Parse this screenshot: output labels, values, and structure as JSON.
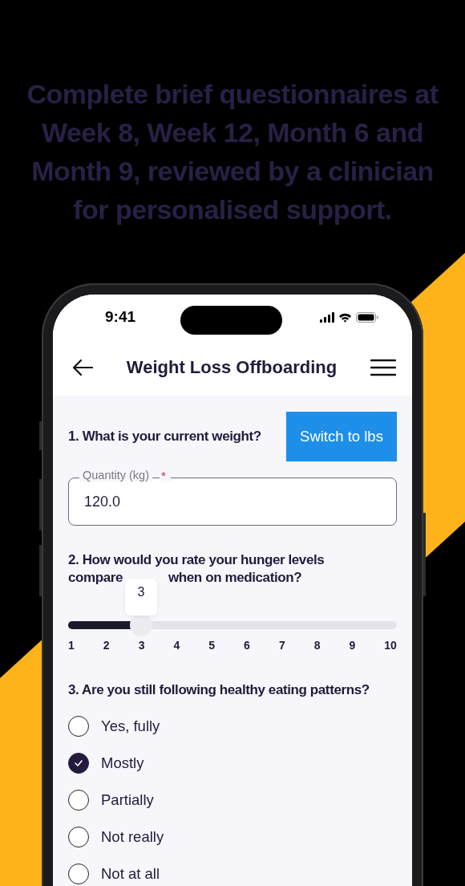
{
  "headline": "Complete brief questionnaires at Week 8, Week 12, Month 6 and Month 9, reviewed by a clinician for personalised support.",
  "status_bar": {
    "time": "9:41"
  },
  "header": {
    "title": "Weight Loss Offboarding"
  },
  "questions": [
    {
      "kind": "weight",
      "text": "1. What is your current weight?",
      "button": "Switch to lbs",
      "field": {
        "label": "Quantity (kg)",
        "required_mark": "*",
        "value": "120.0"
      }
    },
    {
      "kind": "slider",
      "text_lines": [
        "2. How would you rate your hunger levels",
        "compare",
        "when on medication?"
      ],
      "slider": {
        "level": 0.222,
        "value_label": "3",
        "ticks": [
          "1",
          "2",
          "3",
          "4",
          "5",
          "6",
          "7",
          "8",
          "9",
          "10"
        ]
      }
    },
    {
      "kind": "radio",
      "text": "3. Are you still following healthy eating patterns?",
      "options": [
        {
          "label": "Yes, fully",
          "selected": false
        },
        {
          "label": "Mostly",
          "selected": true
        },
        {
          "label": "Partially",
          "selected": false
        },
        {
          "label": "Not really",
          "selected": false
        },
        {
          "label": "Not at all",
          "selected": false
        }
      ]
    }
  ]
}
